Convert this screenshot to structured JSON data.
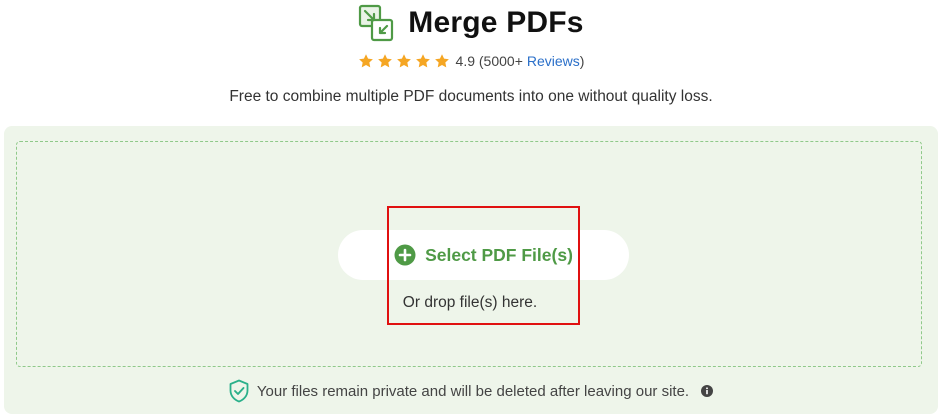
{
  "header": {
    "title": "Merge PDFs",
    "title_icon": "merge-icon",
    "rating": {
      "stars": 5,
      "score_text": "4.9 (5000+",
      "reviews_link": "Reviews",
      "closing": ")"
    },
    "subtitle": "Free to combine multiple PDF documents into one without quality loss."
  },
  "dropzone": {
    "select_button_label": "Select PDF File(s)",
    "drop_hint": "Or drop file(s) here.",
    "privacy_text": "Your files remain private and will be deleted after leaving our site."
  },
  "colors": {
    "accent_green": "#4f9a46",
    "star": "#f5a623",
    "link": "#2a6fc9",
    "dropzone_bg": "#eef5ea",
    "highlight": "#e01010"
  }
}
